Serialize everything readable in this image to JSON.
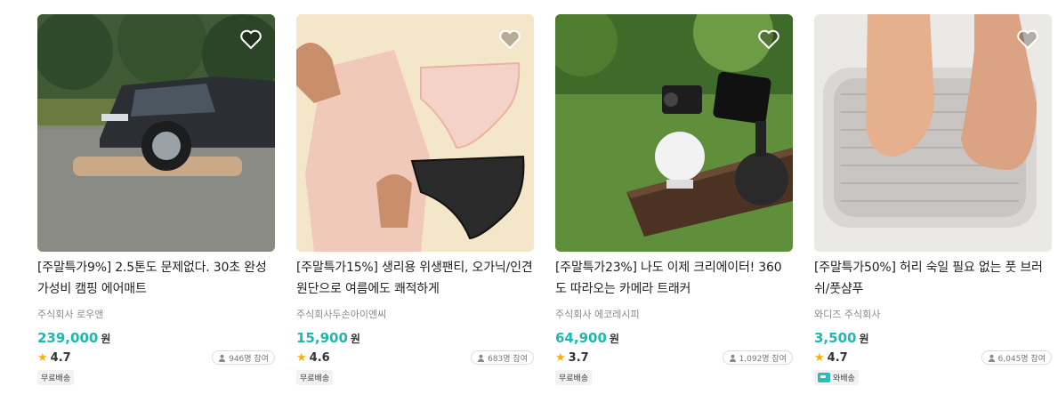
{
  "products": [
    {
      "title": "[주말특가9%] 2.5톤도 문제없다. 30초 완성 가성비 캠핑 에어매트",
      "seller": "주식회사 로우앤",
      "price": "239,000",
      "currency": "원",
      "rating": "4.7",
      "participants": "946명 참여",
      "tag": "무료배송",
      "image_icon": "car-on-air-mattress"
    },
    {
      "title": "[주말특가15%] 생리용 위생팬티, 오가닉/인견원단으로 여름에도 쾌적하게",
      "seller": "주식회사두손아이엔씨",
      "price": "15,900",
      "currency": "원",
      "rating": "4.6",
      "participants": "683명 참여",
      "tag": "무료배송",
      "image_icon": "underwear"
    },
    {
      "title": "[주말특가23%] 나도 이제 크리에이터! 360도 따라오는 카메라 트래커",
      "seller": "주식회사 에코레시피",
      "price": "64,900",
      "currency": "원",
      "rating": "3.7",
      "participants": "1,092명 참여",
      "tag": "무료배송",
      "image_icon": "camera-tracker"
    },
    {
      "title": "[주말특가50%] 허리 숙일 필요 없는 풋 브러쉬/풋샴푸",
      "seller": "와디즈 주식회사",
      "price": "3,500",
      "currency": "원",
      "rating": "4.7",
      "participants": "6,045명 참여",
      "tag": "와배송",
      "image_icon": "foot-brush"
    }
  ],
  "colors": {
    "price": "#1fb8b0",
    "star": "#f5b301",
    "tag_bg": "#f2f2f2"
  }
}
